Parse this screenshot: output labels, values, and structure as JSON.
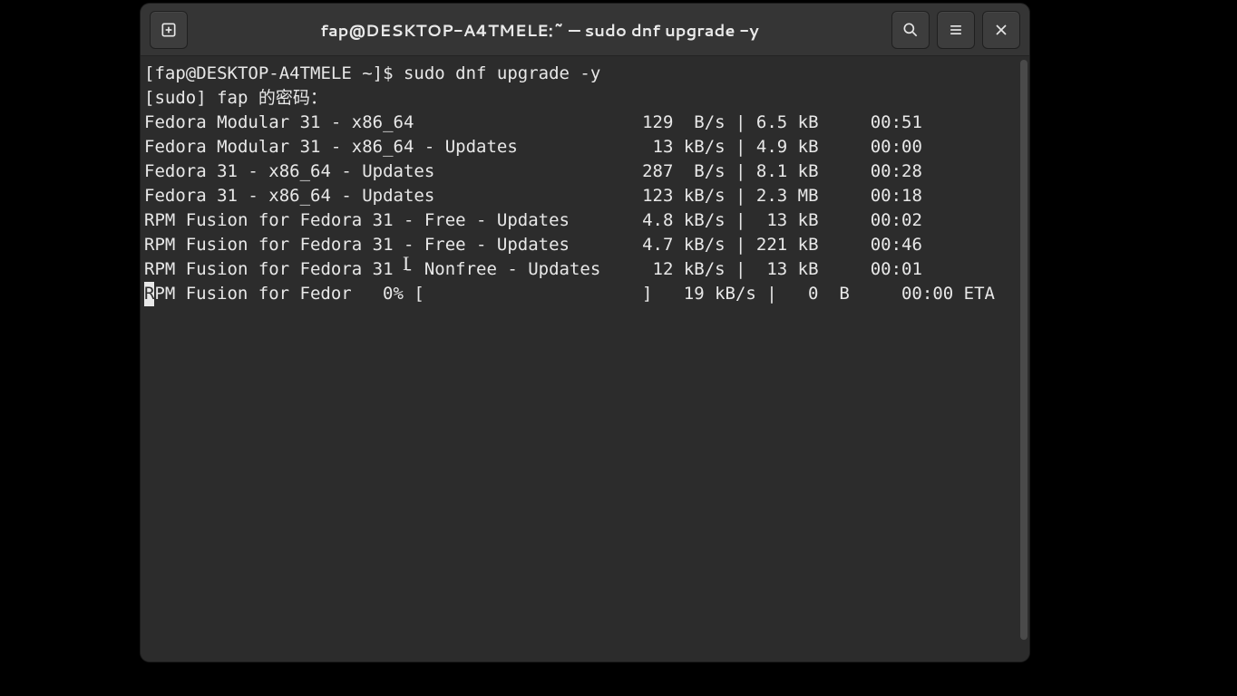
{
  "titlebar": {
    "title": "fap@DESKTOP-A4TMELE:~ — sudo dnf upgrade -y"
  },
  "terminal": {
    "prompt": "[fap@DESKTOP-A4TMELE ~]$ ",
    "command": "sudo dnf upgrade -y",
    "sudo_prompt": "[sudo] fap 的密码：",
    "repos": [
      {
        "name": "Fedora Modular 31 - x86_64",
        "rate": "129  B/s",
        "size": "6.5 kB",
        "time": "00:51"
      },
      {
        "name": "Fedora Modular 31 - x86_64 - Updates",
        "rate": " 13 kB/s",
        "size": "4.9 kB",
        "time": "00:00"
      },
      {
        "name": "Fedora 31 - x86_64 - Updates",
        "rate": "287  B/s",
        "size": "8.1 kB",
        "time": "00:28"
      },
      {
        "name": "Fedora 31 - x86_64 - Updates",
        "rate": "123 kB/s",
        "size": "2.3 MB",
        "time": "00:18"
      },
      {
        "name": "RPM Fusion for Fedora 31 - Free - Updates",
        "rate": "4.8 kB/s",
        "size": " 13 kB",
        "time": "00:02"
      },
      {
        "name": "RPM Fusion for Fedora 31 - Free - Updates",
        "rate": "4.7 kB/s",
        "size": "221 kB",
        "time": "00:46"
      },
      {
        "name": "RPM Fusion for Fedora 31 - Nonfree - Updates",
        "rate": " 12 kB/s",
        "size": " 13 kB",
        "time": "00:01"
      }
    ],
    "progress": {
      "name": "RPM Fusion for Fedor",
      "percent": "0%",
      "bar_open": "[",
      "bar_fill": "                     ",
      "bar_close": "]",
      "rate": " 19 kB/s",
      "size": "  0  B",
      "time": "00:00",
      "eta_label": "ETA"
    }
  }
}
